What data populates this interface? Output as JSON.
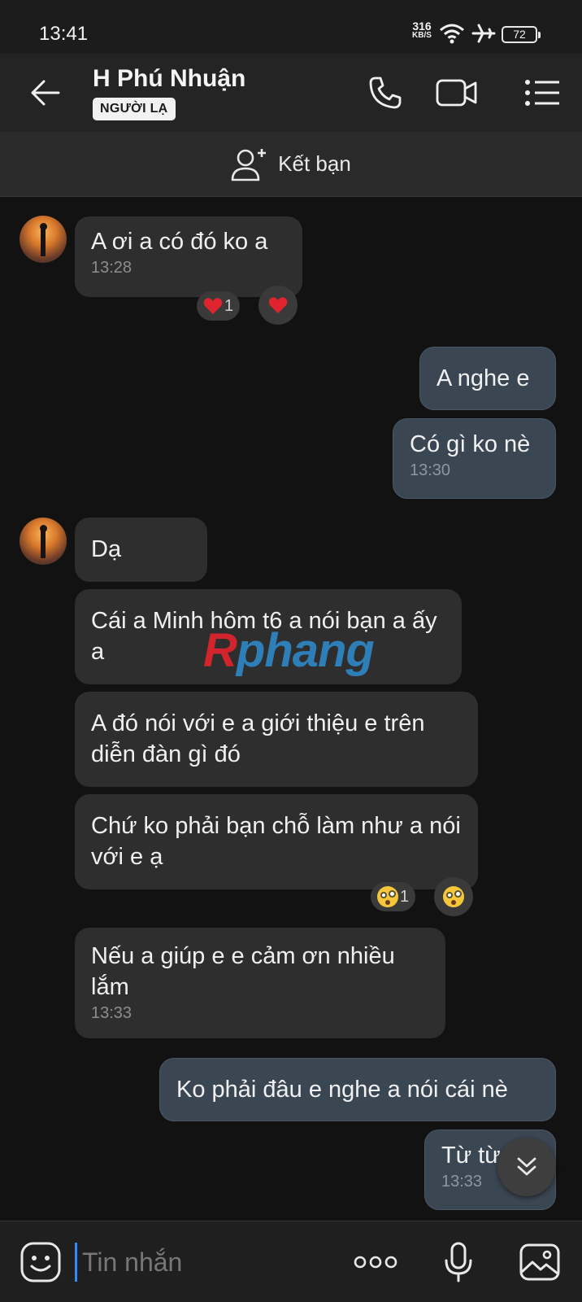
{
  "status_bar": {
    "time": "13:41",
    "net_speed": "316",
    "net_unit": "KB/S",
    "battery": "72"
  },
  "header": {
    "name": "H Phú Nhuận",
    "badge": "NGƯỜI LẠ"
  },
  "friend_bar": {
    "label": "Kết bạn"
  },
  "messages": [
    {
      "dir": "in",
      "text": "A ơi a có đó ko a",
      "time": "13:28"
    },
    {
      "dir": "out",
      "text": "A nghe e",
      "time": ""
    },
    {
      "dir": "out",
      "text": "Có gì ko nè",
      "time": "13:30"
    },
    {
      "dir": "in",
      "text": "Dạ",
      "time": ""
    },
    {
      "dir": "in",
      "text": "Cái a Minh hôm t6 a nói bạn a ấy a",
      "time": ""
    },
    {
      "dir": "in",
      "text": "A đó nói với e a giới thiệu e trên diễn đàn gì đó",
      "time": ""
    },
    {
      "dir": "in",
      "text": "Chứ ko phải bạn chỗ làm như a nói với e ạ",
      "time": ""
    },
    {
      "dir": "in",
      "text": "Nếu a giúp e e cảm ơn nhiều lắm",
      "time": "13:33"
    },
    {
      "dir": "out",
      "text": "Ko phải đâu e nghe a nói cái nè",
      "time": ""
    },
    {
      "dir": "out",
      "text": "Từ từ",
      "time": "13:33"
    }
  ],
  "reactions": {
    "msg1_count": "1",
    "msg7_count": "1"
  },
  "watermark": {
    "part1": "R",
    "part2": "phang"
  },
  "input": {
    "placeholder": "Tin nhắn"
  },
  "colors": {
    "background": "#121212",
    "incoming_bubble": "#2e2e2e",
    "outgoing_bubble": "#3b4653",
    "cursor": "#2f8cff"
  }
}
